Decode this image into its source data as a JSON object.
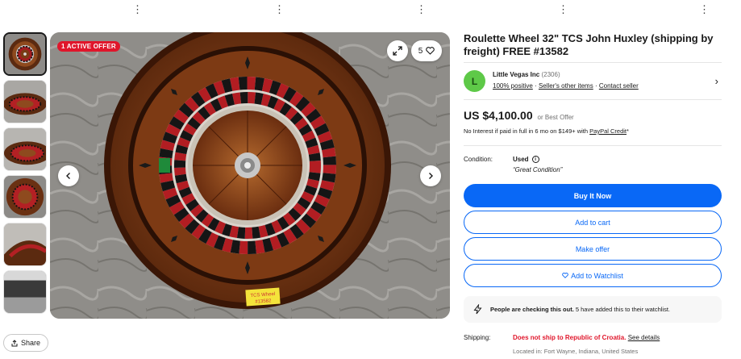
{
  "listing": {
    "title": "Roulette Wheel 32\" TCS John Huxley (shipping by freight) FREE #13582",
    "offer_badge": "1 ACTIVE OFFER",
    "watch_count": "5",
    "share_label": "Share",
    "thumbnails": [
      "thumb-1",
      "thumb-2",
      "thumb-3",
      "thumb-4",
      "thumb-5",
      "thumb-6"
    ]
  },
  "seller": {
    "initial": "L",
    "name": "Little Vegas Inc",
    "feedback_count": "(2306)",
    "positive": "100% positive",
    "other_items": "Seller's other items",
    "contact": "Contact seller",
    "avatar_color": "#5ec948"
  },
  "price": {
    "amount": "US $4,100.00",
    "best_offer": "or Best Offer",
    "finance_prefix": "No Interest if paid in full in 6 mo on $149+ with ",
    "finance_link": "PayPal Credit",
    "finance_suffix": "*"
  },
  "condition": {
    "label": "Condition:",
    "value": "Used",
    "note": "“Great Condition”"
  },
  "actions": {
    "buy_now": "Buy It Now",
    "add_to_cart": "Add to cart",
    "make_offer": "Make offer",
    "watchlist": "Add to Watchlist",
    "accent": "#0968f6"
  },
  "activity": {
    "bold": "People are checking this out.",
    "rest": " 5 have added this to their watchlist."
  },
  "shipping": {
    "label": "Shipping:",
    "warning": "Does not ship to Republic of Croatia.",
    "details_link": "See details",
    "located": "Located in: Fort Wayne, Indiana, United States",
    "warning_color": "#e0162b"
  },
  "photo": {
    "sticker_line1": "TCS Wheel",
    "sticker_line2": "#13582"
  }
}
